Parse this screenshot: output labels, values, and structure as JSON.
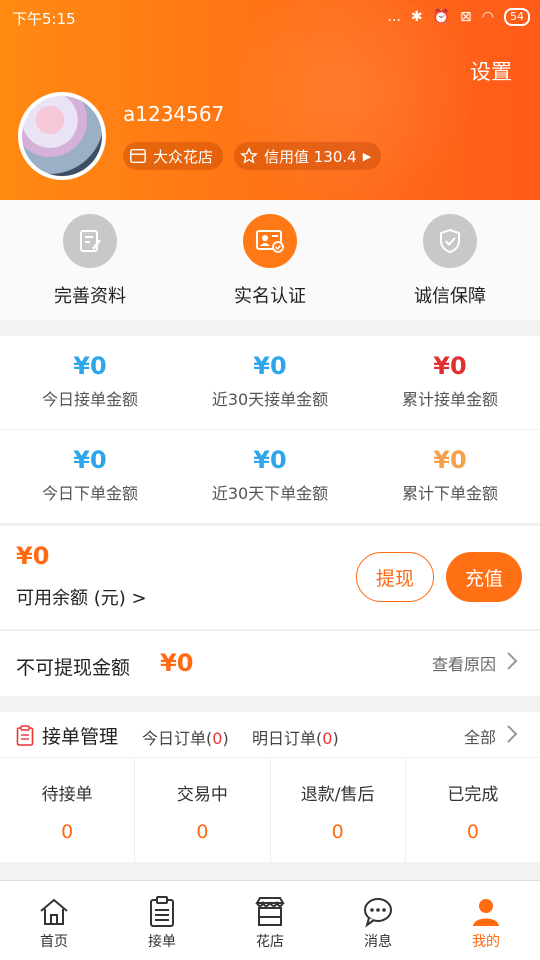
{
  "status_bar": {
    "time": "下午5:15",
    "signal": "...",
    "battery": "54"
  },
  "header": {
    "settings_label": "设置",
    "username": "a1234567",
    "shop_label": "大众花店",
    "credit_label": "信用值 130.4"
  },
  "shortcuts": [
    {
      "label": "完善资料",
      "icon": "edit-profile-icon",
      "active": false
    },
    {
      "label": "实名认证",
      "icon": "id-card-icon",
      "active": true
    },
    {
      "label": "诚信保障",
      "icon": "shield-icon",
      "active": false
    }
  ],
  "stats": {
    "rows": [
      [
        {
          "value": "¥0",
          "label": "今日接单金额",
          "color": "#2fa6ea"
        },
        {
          "value": "¥0",
          "label": "近30天接单金额",
          "color": "#2fa6ea"
        },
        {
          "value": "¥0",
          "label": "累计接单金额",
          "color": "#e03131"
        }
      ],
      [
        {
          "value": "¥0",
          "label": "今日下单金额",
          "color": "#2fa6ea"
        },
        {
          "value": "¥0",
          "label": "近30天下单金额",
          "color": "#2fa6ea"
        },
        {
          "value": "¥0",
          "label": "累计下单金额",
          "color": "#f5a04a"
        }
      ]
    ]
  },
  "balance": {
    "amount": "¥0",
    "available_label": "可用余额 (元) >",
    "withdraw_label": "提现",
    "recharge_label": "充值"
  },
  "non_withdrawable": {
    "label": "不可提现金额",
    "amount": "¥0",
    "reason_label": "查看原因"
  },
  "orders": {
    "title": "接单管理",
    "today_label": "今日订单(",
    "today_count": "0",
    "tomorrow_label": "明日订单(",
    "tomorrow_count": "0",
    "close_paren": ")",
    "all_label": "全部",
    "cells": [
      {
        "label": "待接单",
        "value": "0"
      },
      {
        "label": "交易中",
        "value": "0"
      },
      {
        "label": "退款/售后",
        "value": "0"
      },
      {
        "label": "已完成",
        "value": "0"
      }
    ]
  },
  "bottom_nav": [
    {
      "label": "首页",
      "icon": "home-icon",
      "active": false
    },
    {
      "label": "接单",
      "icon": "clipboard-icon",
      "active": false
    },
    {
      "label": "花店",
      "icon": "store-icon",
      "active": false
    },
    {
      "label": "消息",
      "icon": "chat-icon",
      "active": false
    },
    {
      "label": "我的",
      "icon": "person-icon",
      "active": true
    }
  ],
  "colors": {
    "accent": "#ff6a12",
    "blue": "#2fa6ea",
    "red": "#e03131"
  }
}
